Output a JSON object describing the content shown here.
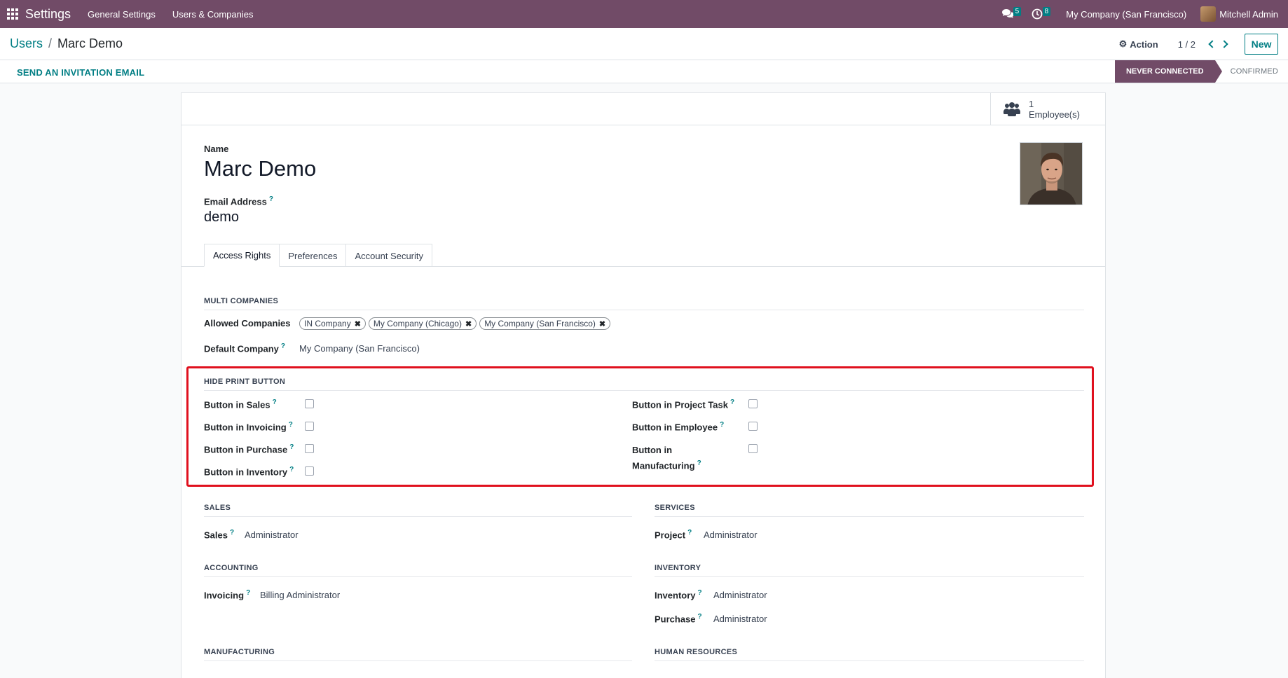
{
  "navbar": {
    "app_title": "Settings",
    "menus": [
      "General Settings",
      "Users & Companies"
    ],
    "messages_count": "5",
    "activities_count": "8",
    "company": "My Company (San Francisco)",
    "user": "Mitchell Admin"
  },
  "control_panel": {
    "breadcrumb_parent": "Users",
    "breadcrumb_sep": "/",
    "breadcrumb_current": "Marc Demo",
    "action_label": "Action",
    "pager": "1 / 2",
    "new_label": "New"
  },
  "status_bar": {
    "invite_label": "SEND AN INVITATION EMAIL",
    "stage_active": "NEVER CONNECTED",
    "stage_next": "CONFIRMED"
  },
  "smart_button": {
    "count": "1",
    "label": "Employee(s)"
  },
  "form": {
    "name_label": "Name",
    "name_value": "Marc Demo",
    "email_label": "Email Address",
    "email_value": "demo",
    "help_mark": "?"
  },
  "tabs": [
    "Access Rights",
    "Preferences",
    "Account Security"
  ],
  "multi_companies": {
    "title": "MULTI COMPANIES",
    "allowed_label": "Allowed Companies",
    "allowed_tags": [
      "IN Company",
      "My Company (Chicago)",
      "My Company (San Francisco)"
    ],
    "default_label": "Default Company",
    "default_value": "My Company (San Francisco)"
  },
  "hide_print": {
    "title": "HIDE PRINT BUTTON",
    "left": [
      "Button in Sales",
      "Button in Invoicing",
      "Button in Purchase",
      "Button in Inventory"
    ],
    "right": [
      "Button in Project Task",
      "Button in Employee",
      "Button in",
      "Manufacturing"
    ],
    "checked": false
  },
  "sections": {
    "sales_title": "SALES",
    "sales_label": "Sales",
    "sales_value": "Administrator",
    "services_title": "SERVICES",
    "project_label": "Project",
    "project_value": "Administrator",
    "accounting_title": "ACCOUNTING",
    "invoicing_label": "Invoicing",
    "invoicing_value": "Billing Administrator",
    "inventory_title": "INVENTORY",
    "inventory_label": "Inventory",
    "inventory_value": "Administrator",
    "purchase_label": "Purchase",
    "purchase_value": "Administrator",
    "manufacturing_title": "MANUFACTURING",
    "hr_title": "HUMAN RESOURCES"
  },
  "colors": {
    "brand": "#714b67",
    "accent": "#017e84",
    "highlight": "#e0101e"
  }
}
